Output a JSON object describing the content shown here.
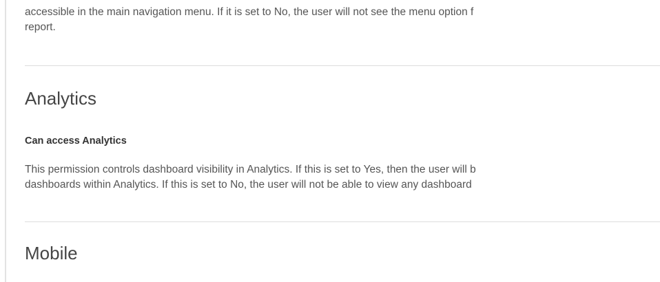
{
  "intro": {
    "line_1": "accessible in the main navigation menu. If it is set to No, the user will not see the menu option f",
    "line_2": "report."
  },
  "analytics_section": {
    "title": "Analytics",
    "permission": {
      "label": "Can access Analytics",
      "description_line_1": "This permission controls dashboard visibility in Analytics. If this is set to Yes, then the user will b",
      "description_line_2": "dashboards within Analytics. If this is set to No, the user will not be able to view any dashboard"
    }
  },
  "mobile_section": {
    "title": "Mobile"
  }
}
